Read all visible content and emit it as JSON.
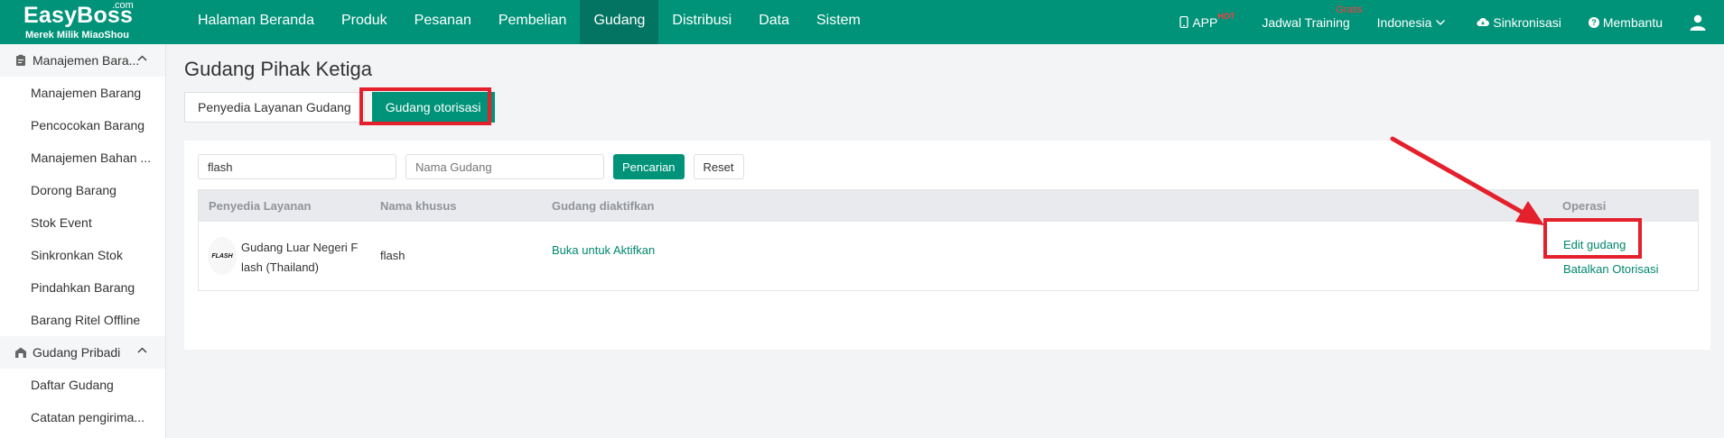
{
  "logo": {
    "brand": "EasyBoss",
    "com": ".com",
    "subtitle": "Merek Milik MiaoShou"
  },
  "nav": [
    "Halaman Beranda",
    "Produk",
    "Pesanan",
    "Pembelian",
    "Gudang",
    "Distribusi",
    "Data",
    "Sistem"
  ],
  "nav_active": "Gudang",
  "right_nav": {
    "app": "APP",
    "app_badge": "HOT",
    "training": "Jadwal Training",
    "training_badge": "Gratis",
    "language": "Indonesia",
    "sync": "Sinkronisasi",
    "help": "Membantu"
  },
  "sidebar": {
    "group1": "Manajemen Bara...",
    "group1_items": [
      "Manajemen Barang",
      "Pencocokan Barang",
      "Manajemen Bahan ...",
      "Dorong Barang",
      "Stok Event",
      "Sinkronkan Stok",
      "Pindahkan Barang",
      "Barang Ritel Offline"
    ],
    "group2": "Gudang Pribadi",
    "group2_items": [
      "Daftar Gudang",
      "Catatan pengirima..."
    ]
  },
  "page": {
    "title": "Gudang Pihak Ketiga",
    "tabs": [
      "Penyedia Layanan Gudang",
      "Gudang otorisasi"
    ]
  },
  "filters": {
    "provider_value": "flash",
    "warehouse_placeholder": "Nama Gudang",
    "search_label": "Pencarian",
    "reset_label": "Reset"
  },
  "table": {
    "headers": [
      "Penyedia Layanan",
      "Nama khusus",
      "Gudang diaktifkan",
      "Operasi"
    ],
    "rows": [
      {
        "logo_text": "FLASH",
        "provider_line1": "Gudang Luar Negeri F",
        "provider_line2": "lash (Thailand)",
        "custom_name": "flash",
        "activated": "Buka untuk Aktifkan",
        "op_edit": "Edit gudang",
        "op_cancel": "Batalkan Otorisasi"
      }
    ]
  },
  "colors": {
    "primary": "#009379",
    "nav_active": "#037461",
    "highlight": "#e3202b",
    "link": "#00876f"
  }
}
